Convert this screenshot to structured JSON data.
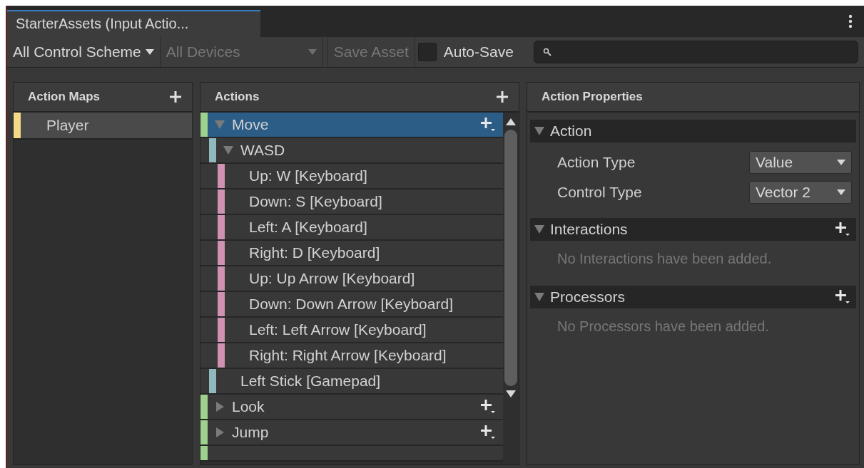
{
  "tab": {
    "title": "StarterAssets (Input Actio..."
  },
  "toolbar": {
    "control_scheme": "All Control Scheme",
    "devices": {
      "label": "All Devices",
      "disabled": true
    },
    "save_button": {
      "label": "Save Asset",
      "disabled": true
    },
    "auto_save": {
      "label": "Auto-Save",
      "checked": false
    }
  },
  "action_maps": {
    "title": "Action Maps",
    "items": [
      {
        "label": "Player",
        "selected": true
      }
    ]
  },
  "actions": {
    "title": "Actions",
    "items": [
      {
        "kind": "action",
        "label": "Move",
        "selected": true,
        "expanded": true,
        "children": [
          {
            "kind": "composite",
            "label": "WASD",
            "selected": false,
            "expanded": true,
            "children": [
              {
                "kind": "part",
                "label": "Up: W [Keyboard]",
                "selected": false
              },
              {
                "kind": "part",
                "label": "Down: S [Keyboard]",
                "selected": false
              },
              {
                "kind": "part",
                "label": "Left: A [Keyboard]",
                "selected": false
              },
              {
                "kind": "part",
                "label": "Right: D [Keyboard]",
                "selected": false
              },
              {
                "kind": "part",
                "label": "Up: Up Arrow [Keyboard]",
                "selected": false
              },
              {
                "kind": "part",
                "label": "Down: Down Arrow [Keyboard]",
                "selected": false
              },
              {
                "kind": "part",
                "label": "Left: Left Arrow [Keyboard]",
                "selected": false
              },
              {
                "kind": "part",
                "label": "Right: Right Arrow [Keyboard]",
                "selected": false
              }
            ]
          },
          {
            "kind": "binding",
            "label": "Left Stick [Gamepad]",
            "selected": false
          }
        ]
      },
      {
        "kind": "action",
        "label": "Look",
        "selected": false,
        "expanded": false
      },
      {
        "kind": "action",
        "label": "Jump",
        "selected": false,
        "expanded": false
      }
    ]
  },
  "properties": {
    "title": "Action Properties",
    "sections": [
      {
        "kind": "fields",
        "title": "Action",
        "expanded": true,
        "fields": [
          {
            "label": "Action Type",
            "value": "Value"
          },
          {
            "label": "Control Type",
            "value": "Vector 2"
          }
        ]
      },
      {
        "kind": "list",
        "title": "Interactions",
        "expanded": true,
        "empty_text": "No Interactions have been added."
      },
      {
        "kind": "list",
        "title": "Processors",
        "expanded": true,
        "empty_text": "No Processors have been added."
      }
    ]
  }
}
